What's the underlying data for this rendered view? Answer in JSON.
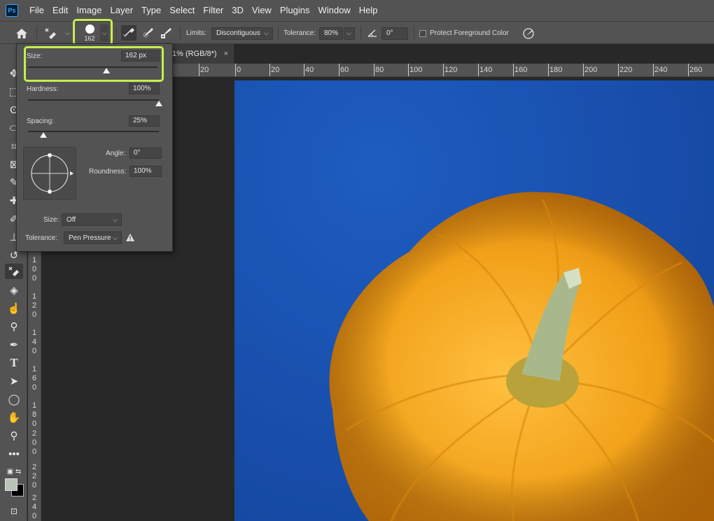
{
  "app": {
    "logo_text": "Ps"
  },
  "menu": [
    "File",
    "Edit",
    "Image",
    "Layer",
    "Type",
    "Select",
    "Filter",
    "3D",
    "View",
    "Plugins",
    "Window",
    "Help"
  ],
  "options_bar": {
    "brush_size_value": "162",
    "limits_label": "Limits:",
    "limits_value": "Discontiguous",
    "tolerance_label": "Tolerance:",
    "tolerance_value": "80%",
    "angle_value": "0°",
    "protect_label": "Protect Foreground Color",
    "protect_checked": false,
    "highlight_color": "#c5ee4f"
  },
  "document_tab": {
    "label": "1% (RGB/8*)",
    "close_symbol": "×"
  },
  "ruler": {
    "horizontal": [
      "20",
      "0",
      "20",
      "40",
      "60",
      "80",
      "100",
      "120",
      "140",
      "160",
      "180",
      "200",
      "220",
      "240",
      "260"
    ],
    "vertical": [
      "100",
      "120",
      "140",
      "160",
      "180",
      "200",
      "220",
      "240"
    ]
  },
  "brush_popup": {
    "size_label": "Size:",
    "size_value": "162 px",
    "size_fraction": 0.6,
    "hardness_label": "Hardness:",
    "hardness_value": "100%",
    "hardness_fraction": 1.0,
    "spacing_label": "Spacing:",
    "spacing_value": "25%",
    "spacing_fraction": 0.12,
    "angle_label": "Angle:",
    "angle_value": "0°",
    "roundness_label": "Roundness:",
    "roundness_value": "100%",
    "dynamic_size_label": "Size:",
    "dynamic_size_value": "Off",
    "dynamic_tolerance_label": "Tolerance:",
    "dynamic_tolerance_value": "Pen Pressure"
  },
  "colors": {
    "foreground": "#b8c4b8",
    "background": "#000000",
    "canvas_blue": "#1a52b0",
    "pumpkin": "#f2a21a"
  }
}
